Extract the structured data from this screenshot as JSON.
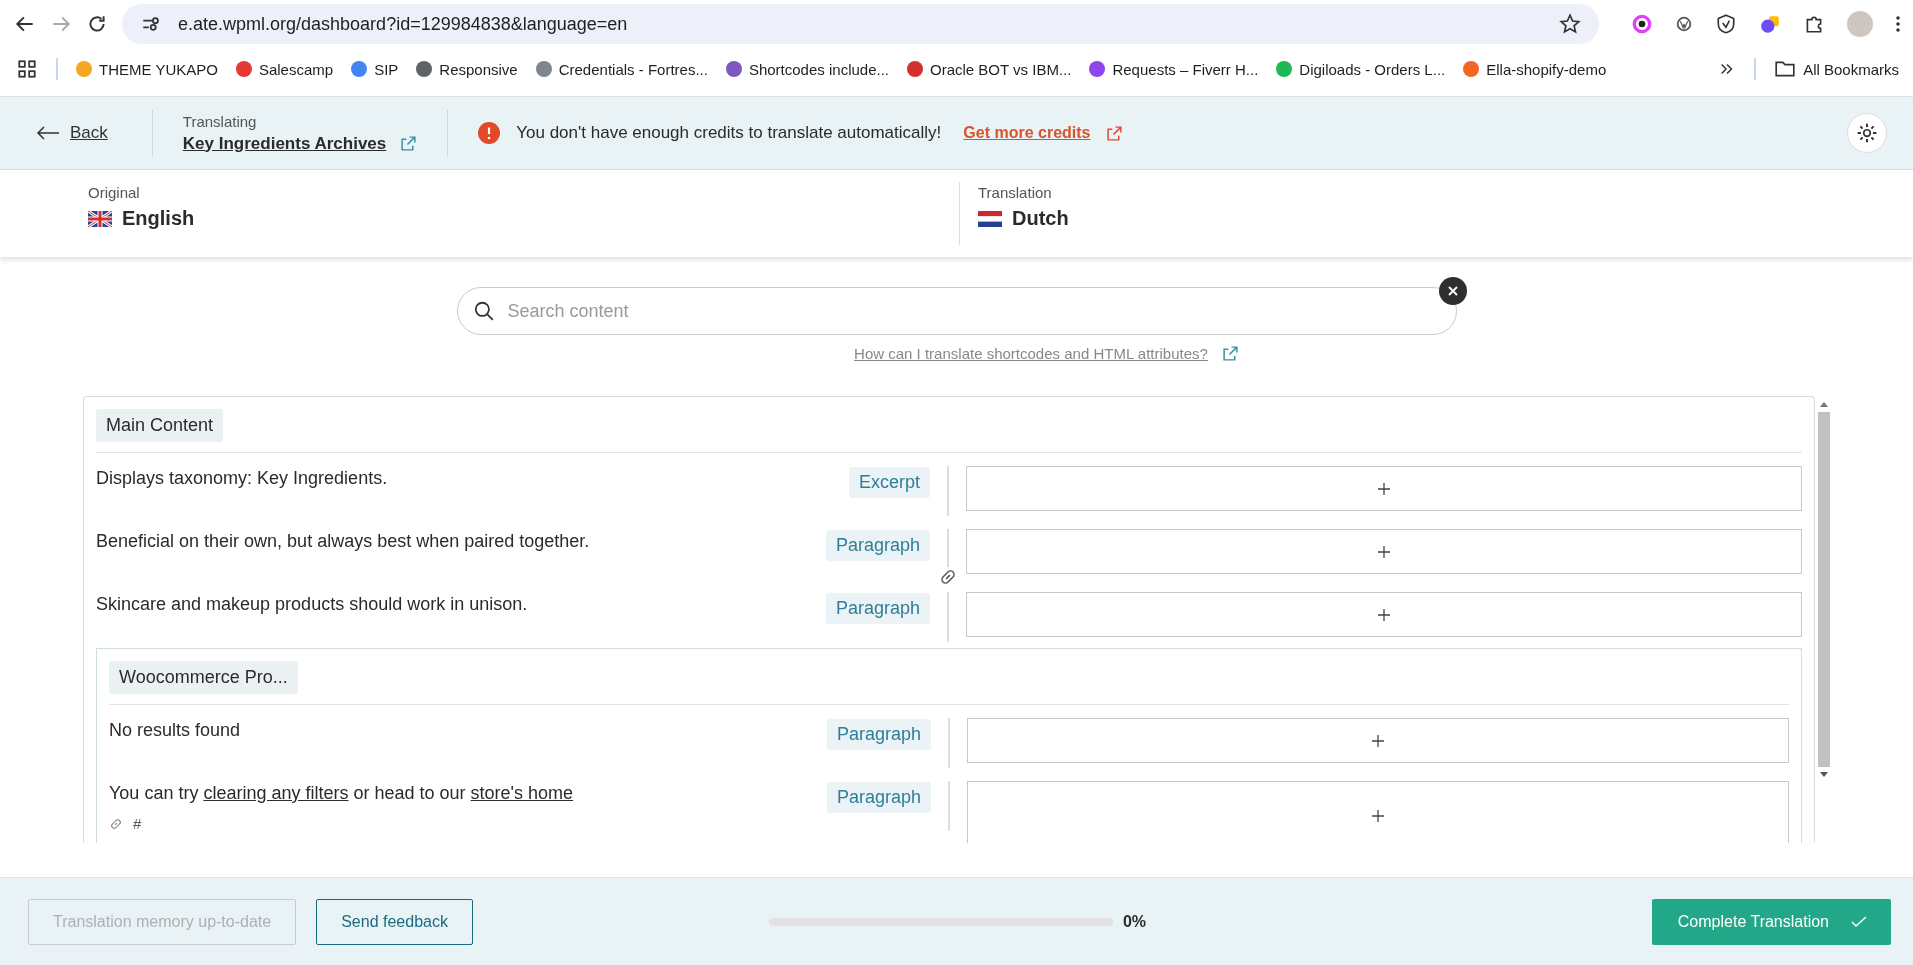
{
  "browser": {
    "url": "e.ate.wpml.org/dashboard?id=129984838&language=en",
    "bookmarks": [
      {
        "label": "THEME YUKAPO",
        "color": "#f5a623"
      },
      {
        "label": "Salescamp",
        "color": "#e53935"
      },
      {
        "label": "SIP",
        "color": "#4285f4"
      },
      {
        "label": "Responsive",
        "color": "#5f6368"
      },
      {
        "label": "Credentials - Fortres...",
        "color": "#80868b"
      },
      {
        "label": "Shortcodes include...",
        "color": "#7e57c2"
      },
      {
        "label": "Oracle BOT vs IBM...",
        "color": "#d32f2f"
      },
      {
        "label": "Requests – Fiverr H...",
        "color": "#8e44ef"
      },
      {
        "label": "Digiloads - Orders L...",
        "color": "#1db954"
      },
      {
        "label": "Ella-shopify-demo",
        "color": "#f26522"
      }
    ],
    "all_bookmarks": "All Bookmarks"
  },
  "header": {
    "back": "Back",
    "translating_label": "Translating",
    "document_title": "Key Ingredients Archives",
    "alert": "You don't have enough credits to translate automatically!",
    "alert_link": "Get more credits"
  },
  "languages": {
    "original": {
      "label": "Original",
      "name": "English"
    },
    "translation": {
      "label": "Translation",
      "name": "Dutch"
    }
  },
  "search": {
    "placeholder": "Search content",
    "help_link": "How can I translate shortcodes and HTML attributes?"
  },
  "section": {
    "title": "Main Content",
    "rows": [
      {
        "segments": [
          {
            "text": "Displays taxonomy: Key Ingredients.",
            "link": false
          }
        ],
        "type": "Excerpt",
        "linked": false
      },
      {
        "segments": [
          {
            "text": "Beneficial on their own, but always best when paired together.",
            "link": false
          }
        ],
        "type": "Paragraph",
        "linked": true
      },
      {
        "segments": [
          {
            "text": "Skincare and makeup products should work in unison.",
            "link": false
          }
        ],
        "type": "Paragraph",
        "linked": false
      }
    ],
    "subsection": {
      "title": "Woocommerce Pro...",
      "rows": [
        {
          "segments": [
            {
              "text": "No results found",
              "link": false
            }
          ],
          "type": "Paragraph",
          "linked": false
        },
        {
          "segments": [
            {
              "text": "You can try ",
              "link": false
            },
            {
              "text": "clearing any filters",
              "link": true
            },
            {
              "text": " or head to our ",
              "link": false
            },
            {
              "text": "store's home",
              "link": true
            }
          ],
          "type": "Paragraph",
          "linked": false,
          "attribute": "#"
        }
      ]
    }
  },
  "footer": {
    "memory_button": {
      "label": "Translation memory up-to-date",
      "disabled": true
    },
    "feedback": "Send feedback",
    "progress": {
      "level": 0,
      "reading": "0%"
    },
    "complete": "Complete Translation"
  }
}
